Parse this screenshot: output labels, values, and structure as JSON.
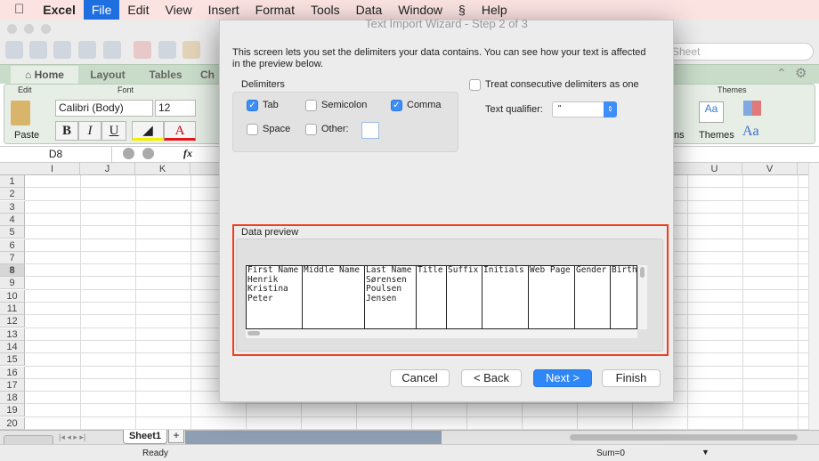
{
  "menubar": {
    "apple": "",
    "app": "Excel",
    "items": [
      "File",
      "Edit",
      "View",
      "Insert",
      "Format",
      "Tools",
      "Data",
      "Window",
      "Help"
    ],
    "script_icon": "§"
  },
  "toolbar": {
    "search_placeholder": "Sheet"
  },
  "ribbon": {
    "tabs": [
      "Home",
      "Layout",
      "Tables",
      "Ch"
    ],
    "edit_label": "Edit",
    "font_label": "Font",
    "paste_label": "Paste",
    "font_name": "Calibri (Body)",
    "font_size": "12",
    "bold": "B",
    "italic": "I",
    "underline": "U",
    "font_color": "A",
    "themes_group": "Themes",
    "themes_label": "Themes",
    "styles_partial": "ns",
    "fonts_btn": "Aa"
  },
  "formula_bar": {
    "name_box": "D8",
    "fx": "fx"
  },
  "grid": {
    "left_columns": [
      "I",
      "J",
      "K"
    ],
    "right_columns": [
      "U",
      "V"
    ],
    "rows": [
      "1",
      "2",
      "3",
      "4",
      "5",
      "6",
      "7",
      "8",
      "9",
      "10",
      "11",
      "12",
      "13",
      "14",
      "15",
      "16",
      "17",
      "18",
      "19",
      "20"
    ],
    "selected_row": "8"
  },
  "sheet_tabs": {
    "tabs": [
      "Sheet1"
    ],
    "add": "+"
  },
  "status": {
    "ready": "Ready",
    "sum": "Sum=0"
  },
  "dialog": {
    "title": "Text Import Wizard - Step 2 of 3",
    "intro": "This screen lets you set the delimiters your data contains.  You can see how your text is affected in the preview below.",
    "delimiters_label": "Delimiters",
    "delimiters": [
      {
        "label": "Tab",
        "checked": true
      },
      {
        "label": "Semicolon",
        "checked": false
      },
      {
        "label": "Comma",
        "checked": true
      },
      {
        "label": "Space",
        "checked": false
      },
      {
        "label": "Other:",
        "checked": false
      }
    ],
    "other_value": "",
    "consecutive_label": "Treat consecutive delimiters as one",
    "consecutive_checked": false,
    "qualifier_label": "Text qualifier:",
    "qualifier_value": "\"",
    "preview_label": "Data preview",
    "preview_columns": [
      {
        "header": "First Name",
        "values": [
          "Henrik",
          "Kristina",
          "Peter"
        ]
      },
      {
        "header": "Middle Name",
        "values": []
      },
      {
        "header": "Last Name",
        "values": [
          "Sørensen",
          "Poulsen",
          "Jensen"
        ]
      },
      {
        "header": "Title",
        "values": []
      },
      {
        "header": "Suffix",
        "values": []
      },
      {
        "header": "Initials",
        "values": []
      },
      {
        "header": "Web Page",
        "values": []
      },
      {
        "header": "Gender",
        "values": []
      },
      {
        "header": "Birth",
        "values": []
      }
    ],
    "buttons": {
      "cancel": "Cancel",
      "back": "< Back",
      "next": "Next >",
      "finish": "Finish"
    },
    "highlight_color": "#f03c1e",
    "primary_color": "#2f86f6"
  }
}
